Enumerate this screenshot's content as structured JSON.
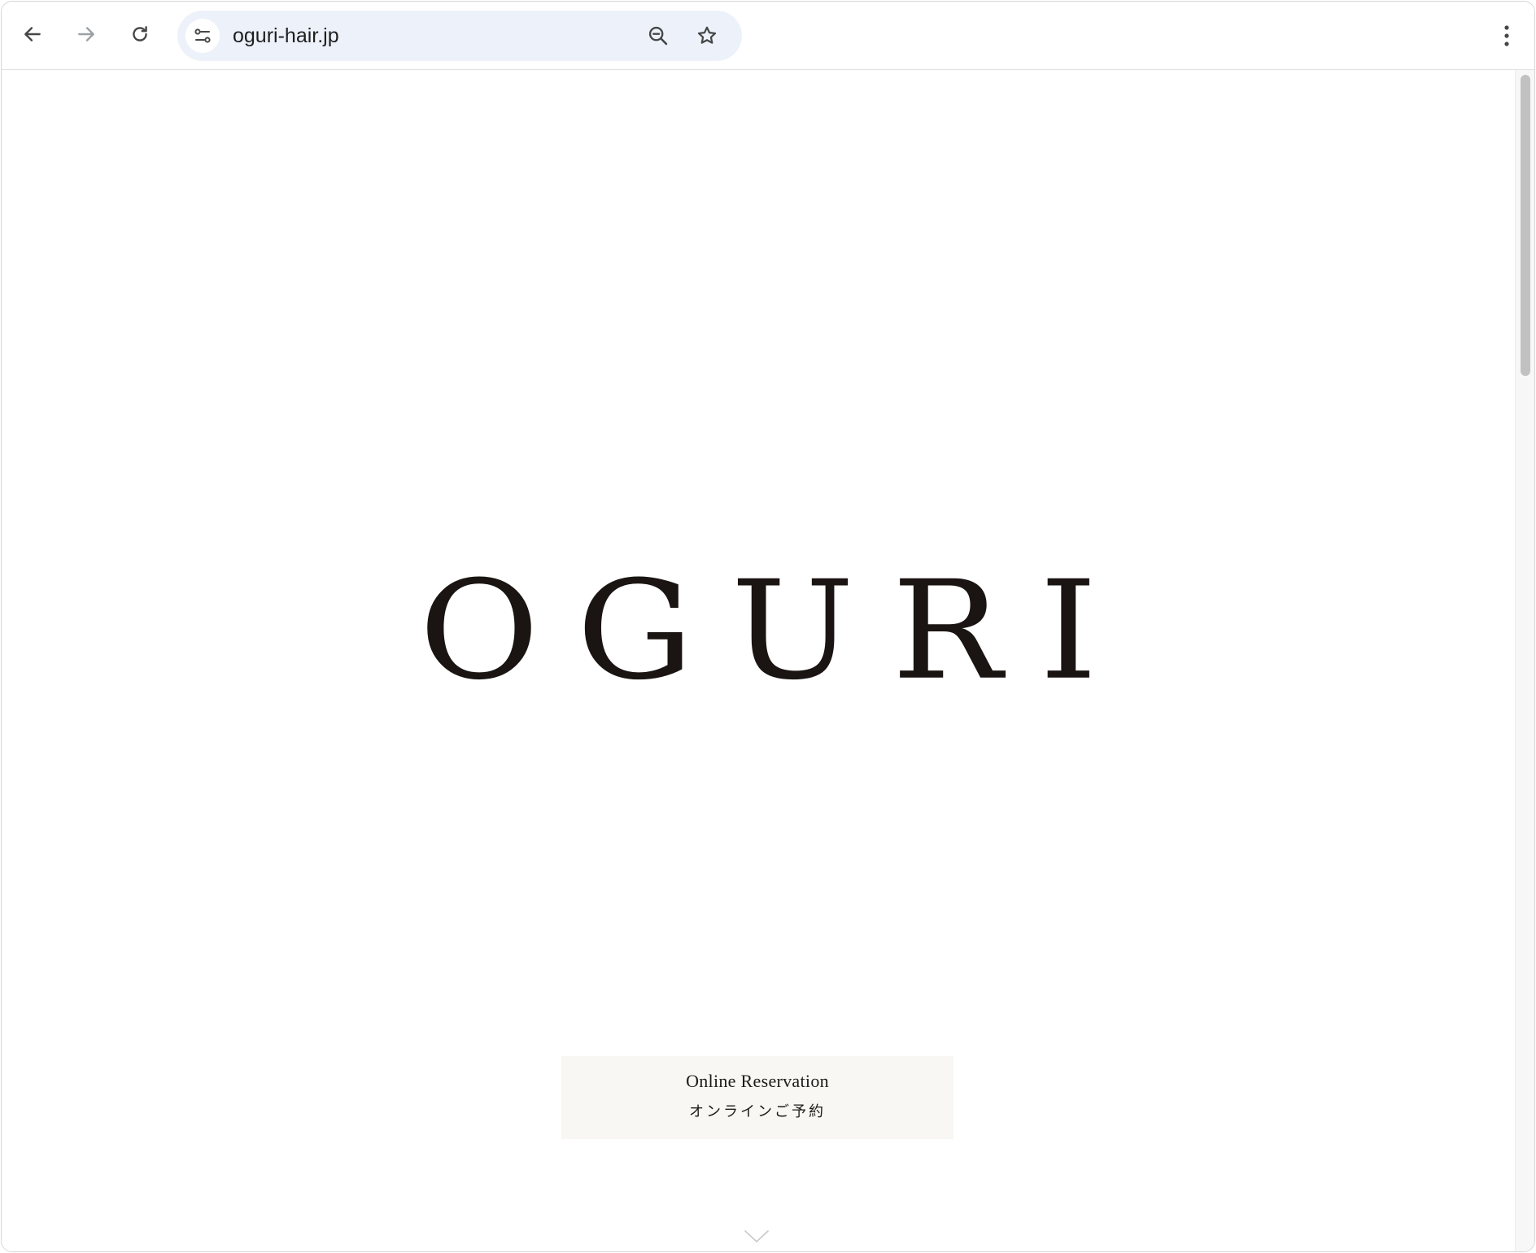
{
  "browser": {
    "url": "oguri-hair.jp",
    "icons": {
      "back": "arrow-left-icon",
      "forward": "arrow-right-icon",
      "reload": "reload-icon",
      "site_info": "tune-icon",
      "zoom": "zoom-out-icon",
      "bookmark": "star-icon",
      "menu": "vertical-dots-icon"
    },
    "colors": {
      "omnibox_bg": "#edf2fa",
      "icon": "#444746",
      "icon_disabled": "#9aa0a6"
    }
  },
  "page": {
    "logo": "OGURI",
    "reservation": {
      "label_en": "Online Reservation",
      "label_jp": "オンラインご予約"
    },
    "scroll_indicator_icon": "chevron-down-icon",
    "colors": {
      "logo": "#1a1413",
      "reservation_bg": "#f8f7f4"
    }
  }
}
